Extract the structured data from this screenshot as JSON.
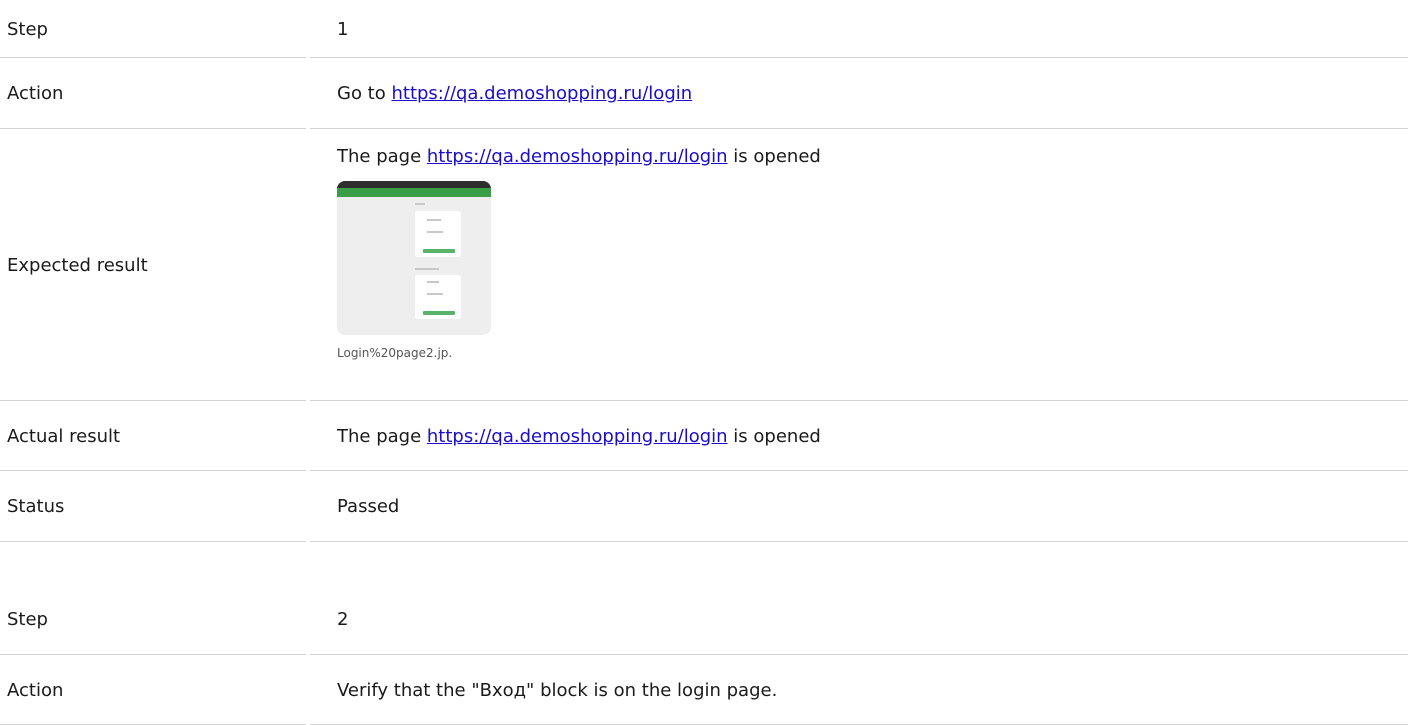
{
  "steps": [
    {
      "step": {
        "label": "Step",
        "value": "1"
      },
      "action": {
        "label": "Action",
        "prefix": "Go to ",
        "link": "https://qa.demoshopping.ru/login"
      },
      "expected": {
        "label": "Expected result",
        "prefix": "The page ",
        "link": "https://qa.demoshopping.ru/login",
        "suffix": " is opened",
        "attachment_caption": "Login%20page2.jp."
      },
      "actual": {
        "label": "Actual result",
        "prefix": "The page ",
        "link": "https://qa.demoshopping.ru/login",
        "suffix": " is opened"
      },
      "status": {
        "label": "Status",
        "value": "Passed"
      }
    },
    {
      "step": {
        "label": "Step",
        "value": "2"
      },
      "action": {
        "label": "Action",
        "text": "Verify that the \"Вход\" block is on the login page."
      }
    }
  ],
  "colors": {
    "link": "#1a0dcc",
    "divider": "#d4d4d4",
    "thumbnail_header": "#2e2e2e",
    "thumbnail_accent": "#3a9e49"
  }
}
